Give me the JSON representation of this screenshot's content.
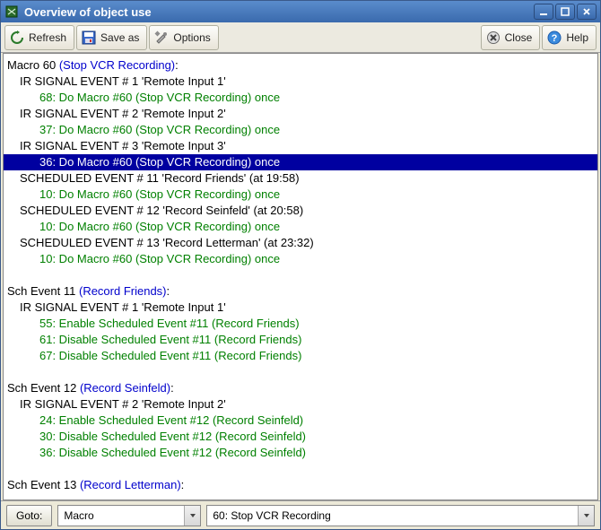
{
  "window": {
    "title": "Overview of object use"
  },
  "toolbar": {
    "refresh": "Refresh",
    "saveas": "Save as",
    "options": "Options",
    "close": "Close",
    "help": "Help"
  },
  "tree": [
    {
      "type": "header",
      "prefix": "Macro 60 ",
      "link": "(Stop VCR Recording)",
      "suffix": ":"
    },
    {
      "type": "event",
      "text": "IR SIGNAL EVENT # 1 'Remote Input 1'"
    },
    {
      "type": "action",
      "text": "68: Do Macro #60 (Stop VCR Recording) once"
    },
    {
      "type": "event",
      "text": "IR SIGNAL EVENT # 2 'Remote Input 2'"
    },
    {
      "type": "action",
      "text": "37: Do Macro #60 (Stop VCR Recording) once"
    },
    {
      "type": "event",
      "text": "IR SIGNAL EVENT # 3 'Remote Input 3'"
    },
    {
      "type": "action",
      "text": "36: Do Macro #60 (Stop VCR Recording) once",
      "selected": true
    },
    {
      "type": "event",
      "text": "SCHEDULED EVENT # 11 'Record Friends' (at 19:58)"
    },
    {
      "type": "action",
      "text": "10: Do Macro #60 (Stop VCR Recording) once"
    },
    {
      "type": "event",
      "text": "SCHEDULED EVENT # 12 'Record Seinfeld' (at 20:58)"
    },
    {
      "type": "action",
      "text": "10: Do Macro #60 (Stop VCR Recording) once"
    },
    {
      "type": "event",
      "text": "SCHEDULED EVENT # 13 'Record Letterman' (at 23:32)"
    },
    {
      "type": "action",
      "text": "10: Do Macro #60 (Stop VCR Recording) once"
    },
    {
      "type": "blank"
    },
    {
      "type": "header",
      "prefix": "Sch Event 11 ",
      "link": "(Record Friends)",
      "suffix": ":"
    },
    {
      "type": "event",
      "text": "IR SIGNAL EVENT # 1 'Remote Input 1'"
    },
    {
      "type": "action",
      "text": "55: Enable Scheduled Event #11 (Record Friends)"
    },
    {
      "type": "action",
      "text": "61: Disable Scheduled Event #11 (Record Friends)"
    },
    {
      "type": "action",
      "text": "67: Disable Scheduled Event #11 (Record Friends)"
    },
    {
      "type": "blank"
    },
    {
      "type": "header",
      "prefix": "Sch Event 12 ",
      "link": "(Record Seinfeld)",
      "suffix": ":"
    },
    {
      "type": "event",
      "text": "IR SIGNAL EVENT # 2 'Remote Input 2'"
    },
    {
      "type": "action",
      "text": "24: Enable Scheduled Event #12 (Record Seinfeld)"
    },
    {
      "type": "action",
      "text": "30: Disable Scheduled Event #12 (Record Seinfeld)"
    },
    {
      "type": "action",
      "text": "36: Disable Scheduled Event #12 (Record Seinfeld)"
    },
    {
      "type": "blank"
    },
    {
      "type": "header",
      "prefix": "Sch Event 13 ",
      "link": "(Record Letterman)",
      "suffix": ":"
    }
  ],
  "bottombar": {
    "goto": "Goto:",
    "combo1": "Macro",
    "combo2": "60: Stop VCR Recording"
  }
}
